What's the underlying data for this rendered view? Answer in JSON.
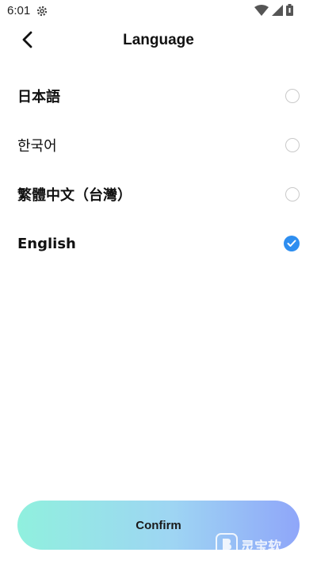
{
  "status_bar": {
    "time": "6:01"
  },
  "header": {
    "title": "Language"
  },
  "languages": [
    {
      "label": "日本語",
      "selected": false
    },
    {
      "label": "한국어",
      "selected": false
    },
    {
      "label": "繁體中文（台灣）",
      "selected": false
    },
    {
      "label": "English",
      "selected": true
    }
  ],
  "footer": {
    "confirm_label": "Confirm"
  },
  "watermark": {
    "text": "灵宝软"
  },
  "colors": {
    "accent": "#2e8ef0",
    "button_gradient_start": "#90f0de",
    "button_gradient_end": "#8fa6f9"
  }
}
